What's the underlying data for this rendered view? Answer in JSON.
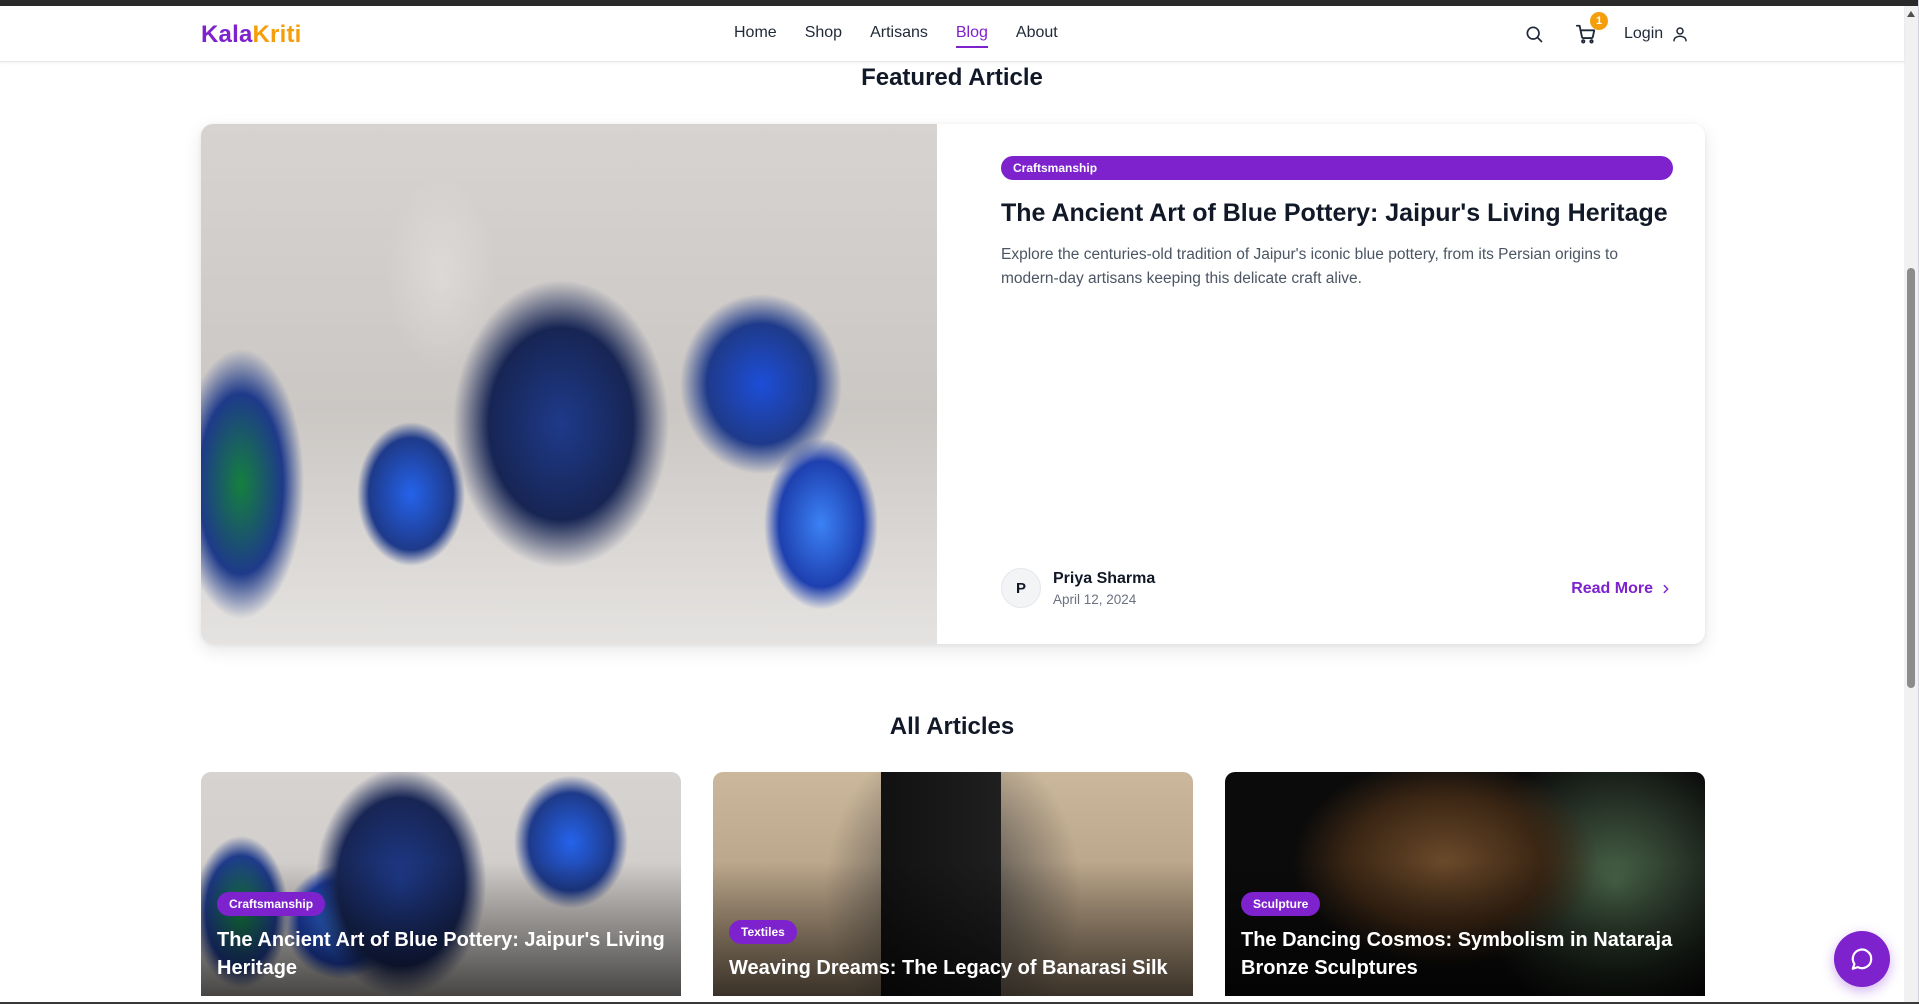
{
  "brand": {
    "part1": "Kala",
    "part2": "Kriti",
    "accent": "#7e22ce",
    "secondary": "#f59e0b"
  },
  "nav": {
    "items": [
      {
        "label": "Home"
      },
      {
        "label": "Shop"
      },
      {
        "label": "Artisans"
      },
      {
        "label": "Blog",
        "active": true
      },
      {
        "label": "About"
      }
    ]
  },
  "header": {
    "search_icon": "search-icon",
    "cart_icon": "cart-icon",
    "cart_count": "1",
    "login_label": "Login",
    "user_icon": "user-icon"
  },
  "featured_section": {
    "title": "Featured Article",
    "article": {
      "category": "Craftsmanship",
      "title": "The Ancient Art of Blue Pottery: Jaipur's Living Heritage",
      "description": "Explore the centuries-old tradition of Jaipur's iconic blue pottery, from its Persian origins to modern-day artisans keeping this delicate craft alive.",
      "author_initial": "P",
      "author_name": "Priya Sharma",
      "date": "April 12, 2024",
      "read_more": "Read More"
    }
  },
  "all_articles_section": {
    "title": "All Articles",
    "articles": [
      {
        "category": "Craftsmanship",
        "title": "The Ancient Art of Blue Pottery: Jaipur's Living Heritage"
      },
      {
        "category": "Textiles",
        "title": "Weaving Dreams: The Legacy of Banarasi Silk"
      },
      {
        "category": "Sculpture",
        "title": "The Dancing Cosmos: Symbolism in Nataraja Bronze Sculptures"
      }
    ]
  },
  "chat": {
    "icon": "chat-icon"
  }
}
